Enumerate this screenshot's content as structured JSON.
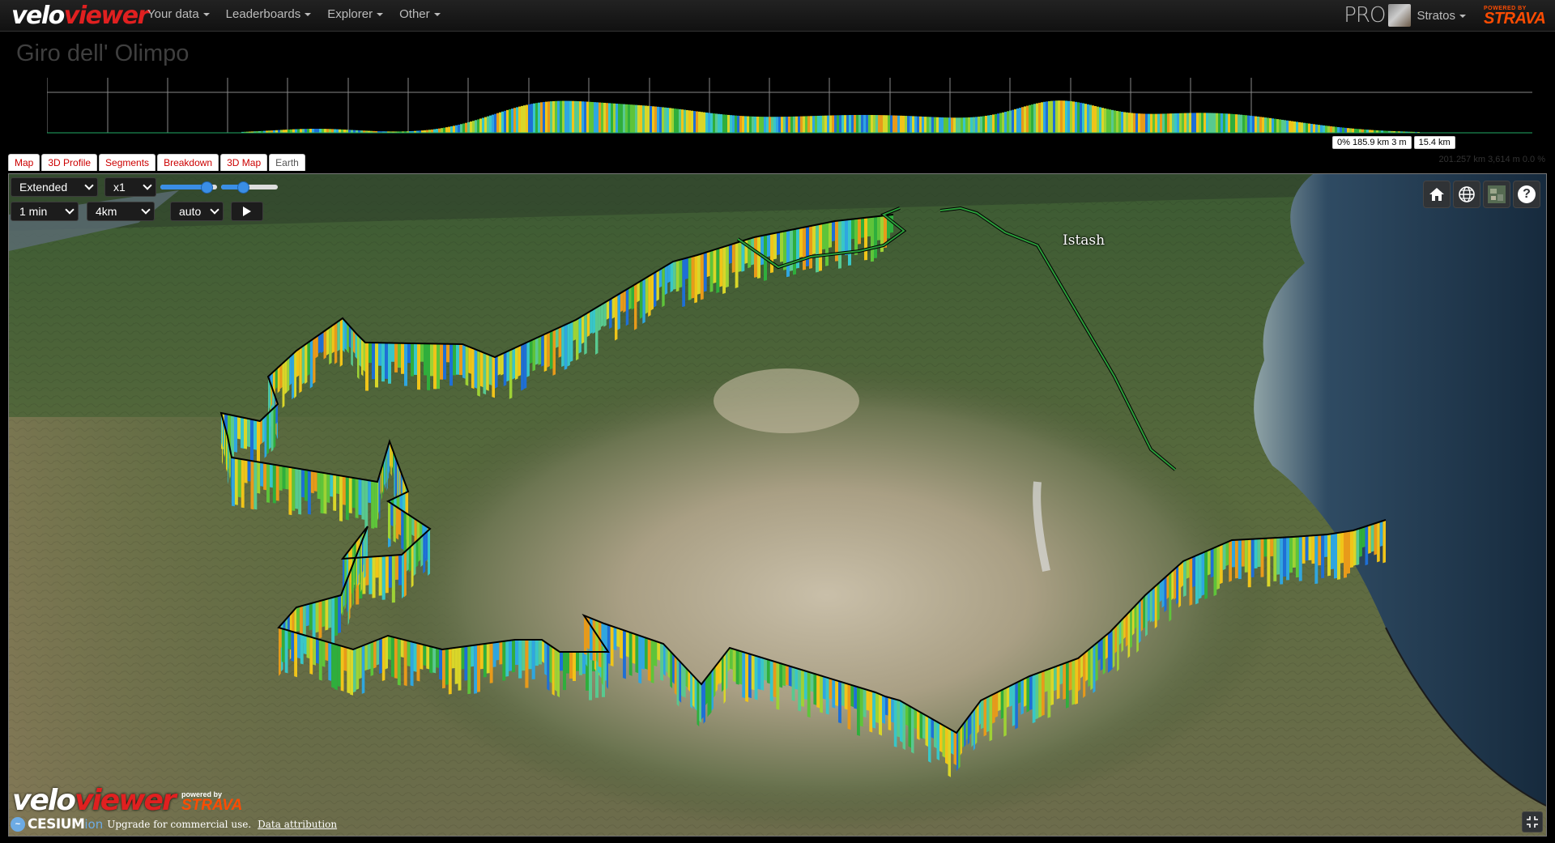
{
  "navbar": {
    "logo_velo": "velo",
    "logo_viewer": "viewer",
    "menu": [
      {
        "label": "Your data"
      },
      {
        "label": "Leaderboards"
      },
      {
        "label": "Explorer"
      },
      {
        "label": "Other"
      }
    ],
    "pro_label": "PRO",
    "user_name": "Stratos",
    "strava_powered": "POWERED BY",
    "strava_word": "STRAVA"
  },
  "page": {
    "title": "Giro dell' Olimpo"
  },
  "profile": {
    "readout_left": "0% 185.9 km 3 m",
    "readout_right": "15.4 km",
    "stats": "201.257 km 3,614 m 0.0 %"
  },
  "tabs": [
    {
      "label": "Map"
    },
    {
      "label": "3D Profile"
    },
    {
      "label": "Segments"
    },
    {
      "label": "Breakdown"
    },
    {
      "label": "3D Map"
    },
    {
      "label": "Earth"
    }
  ],
  "map_controls": {
    "view_mode": "Extended",
    "speed": "x1",
    "interval": "1 min",
    "distance": "4km",
    "camera": "auto",
    "play_icon": "play-icon"
  },
  "map_buttons": [
    {
      "icon": "home-icon"
    },
    {
      "icon": "globe-icon"
    },
    {
      "icon": "layers-icon"
    },
    {
      "icon": "help-icon",
      "glyph": "?"
    }
  ],
  "map_label": "Istash",
  "map_footer": {
    "logo_velo": "velo",
    "logo_viewer": "viewer",
    "strava_powered": "powered by",
    "strava_word": "STRAVA",
    "cesium_word": "CESIUM",
    "ion_word": "ion",
    "upgrade_text": "Upgrade for commercial use.",
    "attribution_link": "Data attribution"
  },
  "colors": {
    "accent_red": "#e02020",
    "strava_orange": "#fc4c02",
    "tab_text": "#cc0000",
    "button_blue": "#3a8ee6"
  }
}
